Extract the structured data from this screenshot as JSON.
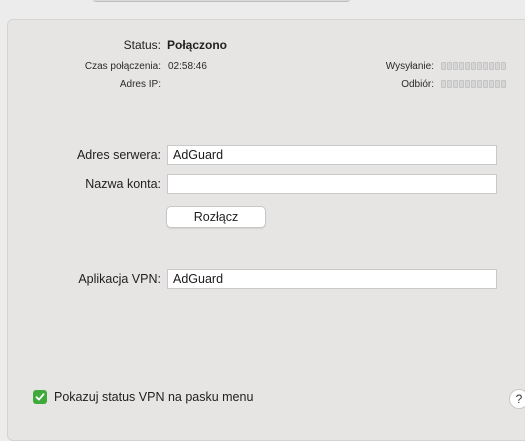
{
  "status": {
    "label": "Status:",
    "value": "Połączono"
  },
  "connection_time": {
    "label": "Czas połączenia:",
    "value": "02:58:46"
  },
  "ip_address": {
    "label": "Adres IP:",
    "value": ""
  },
  "traffic": {
    "sent_label": "Wysyłanie:",
    "received_label": "Odbiór:",
    "sent_level": 0,
    "received_level": 0,
    "meter_segments": 11
  },
  "form": {
    "server_label": "Adres serwera:",
    "server_value": "AdGuard",
    "account_label": "Nazwa konta:",
    "account_value": ""
  },
  "disconnect_button": "Rozłącz",
  "vpn_app": {
    "label": "Aplikacja VPN:",
    "value": "AdGuard"
  },
  "show_status_checkbox": {
    "label": "Pokazuj status VPN na pasku menu",
    "checked": true,
    "color": "#3fa93c"
  },
  "help_button": "?"
}
